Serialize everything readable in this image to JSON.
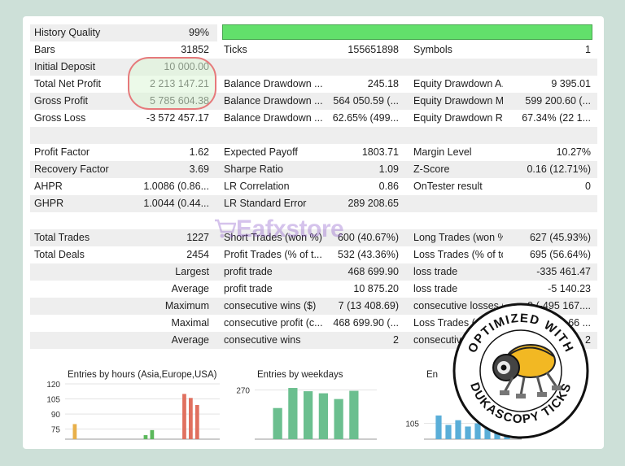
{
  "rows": [
    {
      "c1": {
        "label": "History Quality",
        "value": "99%"
      },
      "c2": null,
      "c3": null
    },
    {
      "c1": {
        "label": "Bars",
        "value": "31852"
      },
      "c2": {
        "label": "Ticks",
        "value": "155651898"
      },
      "c3": {
        "label": "Symbols",
        "value": "1"
      }
    },
    {
      "c1": {
        "label": "Initial Deposit",
        "value": "10 000.00"
      },
      "c2": null,
      "c3": null
    },
    {
      "c1": {
        "label": "Total Net Profit",
        "value": "2 213 147.21"
      },
      "c2": {
        "label": "Balance Drawdown ...",
        "value": "245.18"
      },
      "c3": {
        "label": "Equity Drawdown A...",
        "value": "9 395.01"
      }
    },
    {
      "c1": {
        "label": "Gross Profit",
        "value": "5 785 604.38"
      },
      "c2": {
        "label": "Balance Drawdown ...",
        "value": "564 050.59 (..."
      },
      "c3": {
        "label": "Equity Drawdown M...",
        "value": "599 200.60 (..."
      }
    },
    {
      "c1": {
        "label": "Gross Loss",
        "value": "-3 572 457.17"
      },
      "c2": {
        "label": "Balance Drawdown ...",
        "value": "62.65% (499..."
      },
      "c3": {
        "label": "Equity Drawdown R...",
        "value": "67.34% (22 1..."
      }
    },
    null,
    {
      "c1": {
        "label": "Profit Factor",
        "value": "1.62"
      },
      "c2": {
        "label": "Expected Payoff",
        "value": "1803.71"
      },
      "c3": {
        "label": "Margin Level",
        "value": "10.27%"
      }
    },
    {
      "c1": {
        "label": "Recovery Factor",
        "value": "3.69"
      },
      "c2": {
        "label": "Sharpe Ratio",
        "value": "1.09"
      },
      "c3": {
        "label": "Z-Score",
        "value": "0.16 (12.71%)"
      }
    },
    {
      "c1": {
        "label": "AHPR",
        "value": "1.0086 (0.86..."
      },
      "c2": {
        "label": "LR Correlation",
        "value": "0.86"
      },
      "c3": {
        "label": "OnTester result",
        "value": "0"
      }
    },
    {
      "c1": {
        "label": "GHPR",
        "value": "1.0044 (0.44..."
      },
      "c2": {
        "label": "LR Standard Error",
        "value": "289 208.65"
      },
      "c3": null
    },
    null,
    {
      "c1": {
        "label": "Total Trades",
        "value": "1227"
      },
      "c2": {
        "label": "Short Trades (won %)",
        "value": "600 (40.67%)"
      },
      "c3": {
        "label": "Long Trades (won %)",
        "value": "627 (45.93%)"
      }
    },
    {
      "c1": {
        "label": "Total Deals",
        "value": "2454"
      },
      "c2": {
        "label": "Profit Trades (% of t...",
        "value": "532 (43.36%)"
      },
      "c3": {
        "label": "Loss Trades (% of to...",
        "value": "695 (56.64%)"
      }
    },
    {
      "c1": {
        "label": "",
        "value": "Largest"
      },
      "c2": {
        "label": "profit trade",
        "value": "468 699.90"
      },
      "c3": {
        "label": "loss trade",
        "value": "-335 461.47"
      }
    },
    {
      "c1": {
        "label": "",
        "value": "Average"
      },
      "c2": {
        "label": "profit trade",
        "value": "10 875.20"
      },
      "c3": {
        "label": "loss trade",
        "value": "-5 140.23"
      }
    },
    {
      "c1": {
        "label": "",
        "value": "Maximum"
      },
      "c2": {
        "label": "consecutive wins ($)",
        "value": "7 (13 408.69)"
      },
      "c3": {
        "label": "consecutive losses ($)",
        "value": "9 (-495 167...."
      }
    },
    {
      "c1": {
        "label": "",
        "value": "Maximal"
      },
      "c2": {
        "label": "consecutive profit (c...",
        "value": "468 699.90 (..."
      },
      "c3": {
        "label": "Loss Trades (...",
        "value": "66 ..."
      }
    },
    {
      "c1": {
        "label": "",
        "value": "Average"
      },
      "c2": {
        "label": "consecutive wins",
        "value": "2"
      },
      "c3": {
        "label": "consecutive ...",
        "value": "2"
      }
    },
    null
  ],
  "history_quality_fill": 1.0,
  "watermark": "Eafxstore",
  "badge": {
    "top_text": "OPTIMIZED WITH",
    "bottom_text": "DUKASCOPY TICKS"
  },
  "chart_data": [
    {
      "type": "bar",
      "title": "Entries by hours (Asia,Europe,USA)",
      "xlabel": "",
      "ylabel": "",
      "yticks": [
        120,
        105,
        90,
        75
      ],
      "ylim": [
        65,
        120
      ],
      "bars": [
        {
          "x": 1,
          "value": 80,
          "color": "#e8b04a"
        },
        {
          "x": 12,
          "value": 69,
          "color": "#5cb85c"
        },
        {
          "x": 13,
          "value": 74,
          "color": "#5cb85c"
        },
        {
          "x": 18,
          "value": 110,
          "color": "#e0705f"
        },
        {
          "x": 19,
          "value": 106,
          "color": "#e0705f"
        },
        {
          "x": 20,
          "value": 99,
          "color": "#e0705f"
        }
      ],
      "xrange": [
        0,
        23
      ]
    },
    {
      "type": "bar",
      "title": "Entries by weekdays",
      "xlabel": "",
      "ylabel": "",
      "yticks": [
        270
      ],
      "ylim": [
        150,
        285
      ],
      "bars": [
        {
          "x": 1,
          "value": 226,
          "color": "#6bbf8f"
        },
        {
          "x": 2,
          "value": 275,
          "color": "#6bbf8f"
        },
        {
          "x": 3,
          "value": 267,
          "color": "#6bbf8f"
        },
        {
          "x": 4,
          "value": 262,
          "color": "#6bbf8f"
        },
        {
          "x": 5,
          "value": 248,
          "color": "#6bbf8f"
        },
        {
          "x": 6,
          "value": 268,
          "color": "#6bbf8f"
        }
      ],
      "xrange": [
        0,
        7
      ]
    },
    {
      "type": "bar",
      "title": "En",
      "xlabel": "",
      "ylabel": "",
      "yticks": [
        105
      ],
      "ylim": [
        95,
        130
      ],
      "bars": [
        {
          "x": 1,
          "value": 110,
          "color": "#5aaed8"
        },
        {
          "x": 2,
          "value": 104,
          "color": "#5aaed8"
        },
        {
          "x": 3,
          "value": 107,
          "color": "#5aaed8"
        },
        {
          "x": 4,
          "value": 103,
          "color": "#5aaed8"
        },
        {
          "x": 5,
          "value": 105,
          "color": "#5aaed8"
        },
        {
          "x": 6,
          "value": 102,
          "color": "#5aaed8"
        },
        {
          "x": 7,
          "value": 106,
          "color": "#5aaed8"
        },
        {
          "x": 8,
          "value": 101,
          "color": "#5aaed8"
        }
      ],
      "xrange": [
        0,
        9
      ]
    }
  ]
}
